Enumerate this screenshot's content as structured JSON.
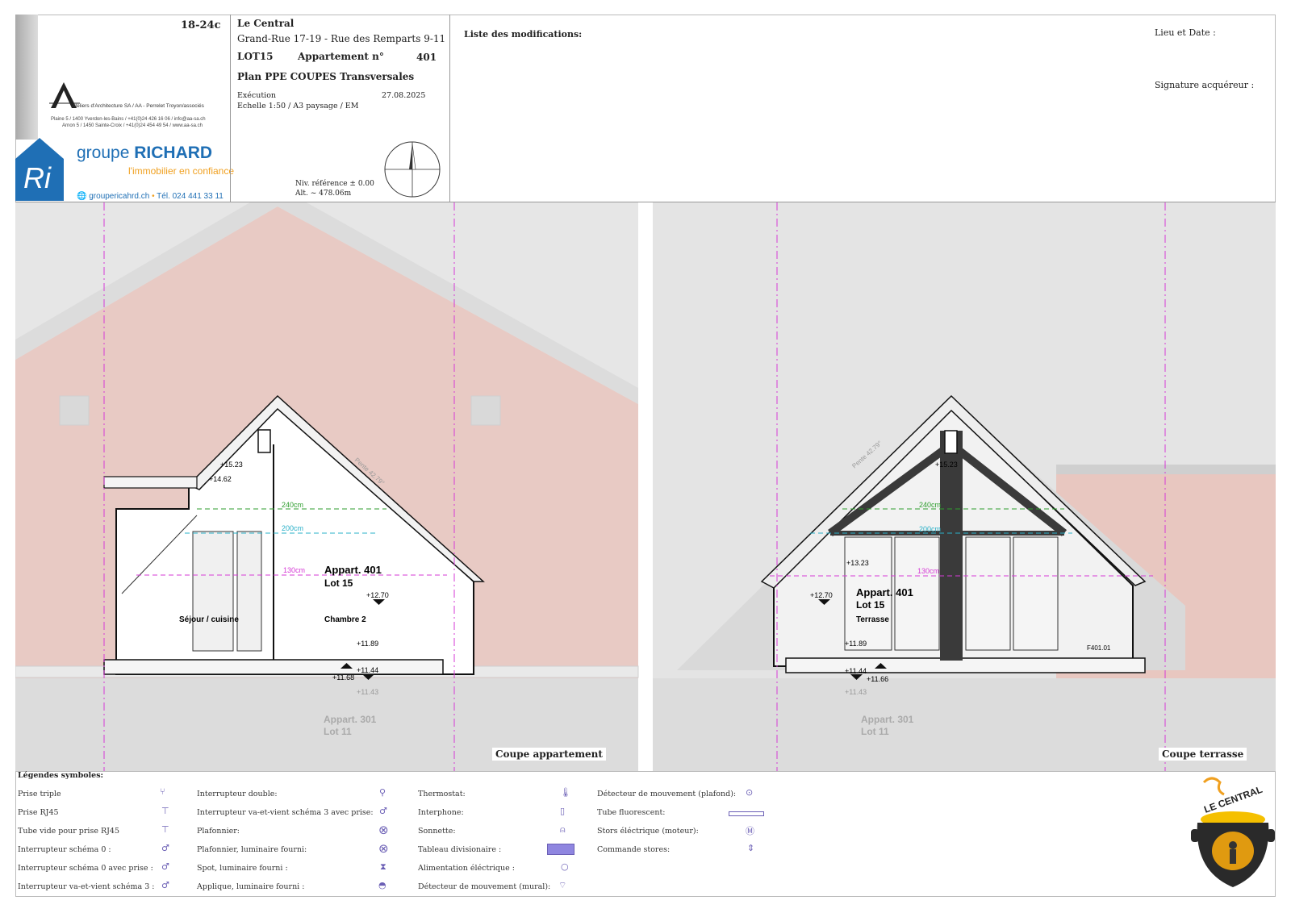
{
  "project_code": "18-24c",
  "architect": {
    "name": "Ateliers d'Architecture SA / AA - Perrelet Troyon/associés",
    "address1": "Plaine 5 / 1400 Yverdon-les-Bains / +41(0)24 426 16 06 / info@aa-sa.ch",
    "address2": "Arnon 5 / 1450 Sainte-Croix / +41(0)24 454 49 54 / www.aa-sa.ch"
  },
  "agency": {
    "name_prefix": "groupe",
    "name_main": "RICHARD",
    "tagline": "l'immobilier en confiance",
    "website": "groupericahrd.ch",
    "phone": "Tél. 024 441 33 11"
  },
  "project": {
    "name": "Le Central",
    "address": "Grand-Rue 17-19 - Rue des Remparts 9-11",
    "lot": "LOT15",
    "apartment_label": "Appartement n°",
    "apartment_number": "401",
    "plan_title": "Plan PPE COUPES Transversales",
    "phase": "Exécution",
    "date": "27.08.2025",
    "scale": "Echelle 1:50 / A3 paysage / EM",
    "reference_level": "Niv. référence ± 0.00",
    "altitude": "Alt. ~ 478.06m"
  },
  "modifications": {
    "label": "Liste des modifications:"
  },
  "signature": {
    "place_date": "Lieu et Date :",
    "signature_label": "Signature acquéreur :"
  },
  "sections": {
    "left": {
      "label": "Coupe appartement",
      "apartment": "Appart. 401",
      "lot": "Lot 15",
      "room1": "Séjour / cuisine",
      "room2": "Chambre 2",
      "below_apartment": "Appart. 301",
      "below_lot": "Lot 11",
      "levels": [
        "+15.23",
        "+14.62",
        "+12.70",
        "+11.89",
        "+11.44",
        "+11.68",
        "+11.43"
      ],
      "h240": "240cm",
      "h200": "200cm",
      "h130": "130cm",
      "slope": "Pente 42.79°"
    },
    "right": {
      "label": "Coupe terrasse",
      "apartment": "Appart. 401",
      "lot": "Lot 15",
      "room1": "Terrasse",
      "below_apartment": "Appart. 301",
      "below_lot": "Lot 11",
      "levels": [
        "+15.23",
        "+13.23",
        "+12.70",
        "+11.89",
        "+11.44",
        "+11.66",
        "+11.43"
      ],
      "h240": "240cm",
      "h200": "200cm",
      "h130": "130cm",
      "window_ref": "F401.01",
      "slope": "Pente 42.79°"
    }
  },
  "legend": {
    "title": "Légendes symboles:",
    "col1": [
      "Prise triple",
      "Prise RJ45",
      "Tube vide pour prise RJ45",
      "Interrupteur schéma 0 :",
      "Interrupteur schéma 0 avec prise :",
      "Interrupteur va-et-vient schéma 3 :"
    ],
    "col2": [
      "Interrupteur double:",
      "Interrupteur va-et-vient schéma 3 avec prise:",
      "Plafonnier:",
      "Plafonnier, luminaire fourni:",
      "Spot, luminaire fourni :",
      "Applique, luminaire fourni :"
    ],
    "col3": [
      "Thermostat:",
      "Interphone:",
      "Sonnette:",
      "Tableau divisionaire :",
      "Alimentation éléctrique :",
      "Détecteur de mouvement (mural):"
    ],
    "col4": [
      "Détecteur de mouvement (plafond):",
      "Tube fluorescent:",
      "Stors éléctrique (moteur):",
      "Commande stores:"
    ]
  },
  "logo_text": "LE CENTRAL",
  "colors": {
    "accent_blue": "#1f6fb5",
    "orange": "#f0a020",
    "magenta": "#d63ad6",
    "green": "#2e9e2e",
    "cyan": "#2ab0c8",
    "bg_grey": "#e6e6e6",
    "pink_facade": "#e8c7c0"
  }
}
